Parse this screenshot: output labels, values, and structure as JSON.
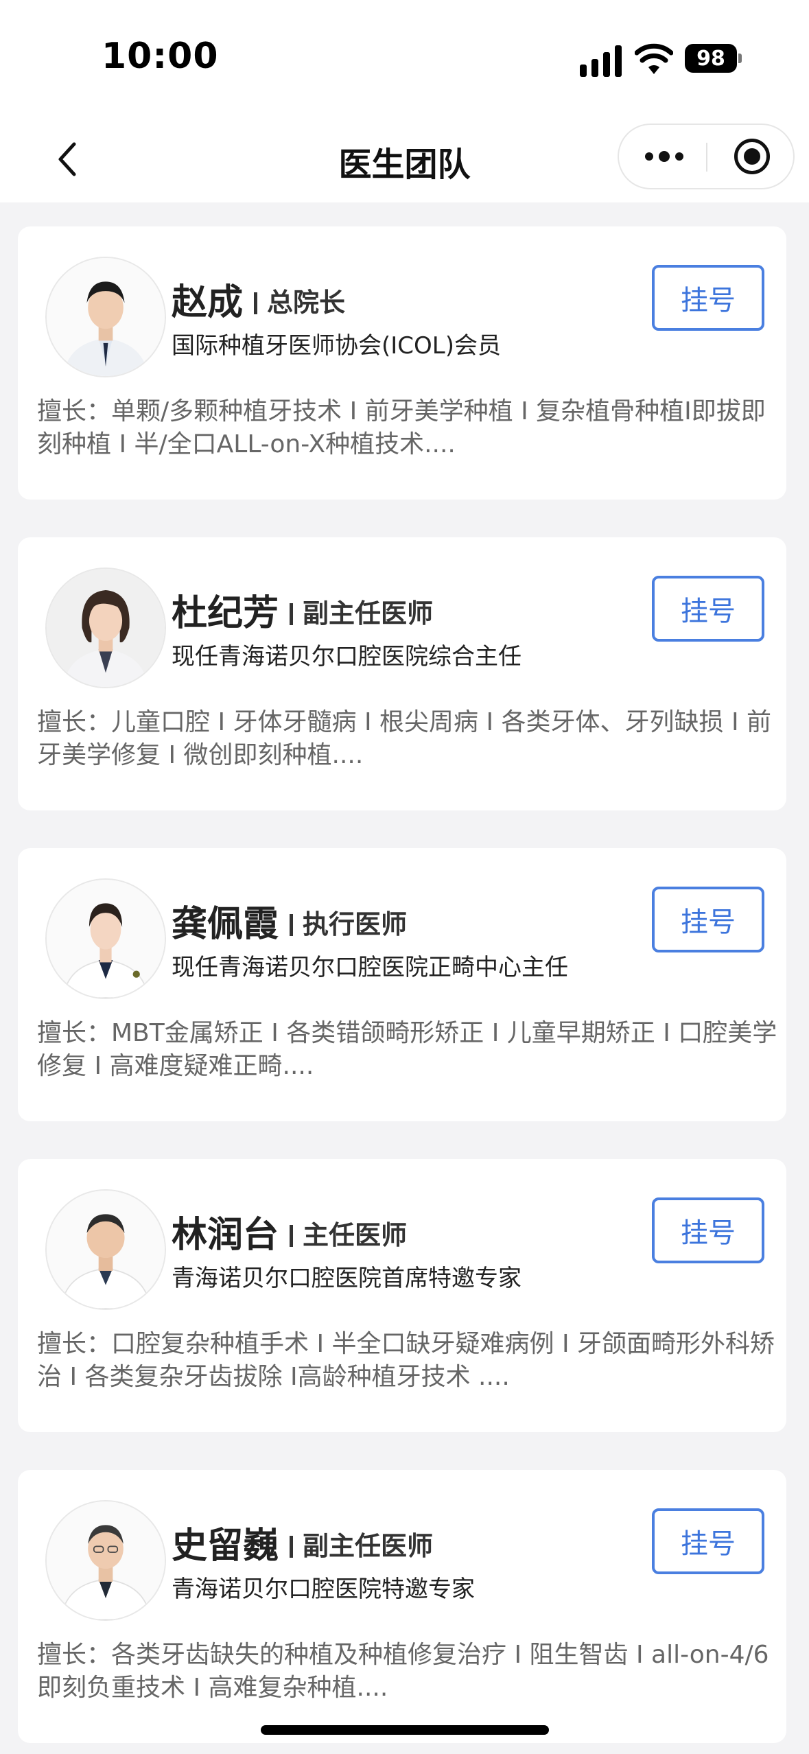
{
  "status_bar": {
    "time": "10:00",
    "battery": "98"
  },
  "nav": {
    "title": "医生团队"
  },
  "doctors": [
    {
      "name": "赵成",
      "title": "总院长",
      "desc": "国际种植牙医师协会(ICOL)会员",
      "skills": "擅长：单颗/多颗种植牙技术 I 前牙美学种植 I 复杂植骨种植I即拔即刻种植 I 半/全口ALL-on-X种植技术....",
      "button": "挂号"
    },
    {
      "name": "杜纪芳",
      "title": "副主任医师",
      "desc": "现任青海诺贝尔口腔医院综合主任",
      "skills": "擅长：儿童口腔 I 牙体牙髓病 I 根尖周病 I 各类牙体、牙列缺损 I 前牙美学修复 I 微创即刻种植....",
      "button": "挂号"
    },
    {
      "name": "龚佩霞",
      "title": "执行医师",
      "desc": "现任青海诺贝尔口腔医院正畸中心主任",
      "skills": "擅长：MBT金属矫正 I 各类错颌畸形矫正 I 儿童早期矫正 I 口腔美学修复 I 高难度疑难正畸....",
      "button": "挂号"
    },
    {
      "name": "林润台",
      "title": "主任医师",
      "desc": "青海诺贝尔口腔医院首席特邀专家",
      "skills": "擅长：口腔复杂种植手术 I 半全口缺牙疑难病例 I 牙颌面畸形外科矫治 I 各类复杂牙齿拔除 I高龄种植牙技术 ....",
      "button": "挂号"
    },
    {
      "name": "史留巍",
      "title": "副主任医师",
      "desc": "青海诺贝尔口腔医院特邀专家",
      "skills": "擅长：各类牙齿缺失的种植及种植修复治疗 I 阻生智齿 I all-on-4/6即刻负重技术 I 高难复杂种植....",
      "button": "挂号"
    }
  ]
}
